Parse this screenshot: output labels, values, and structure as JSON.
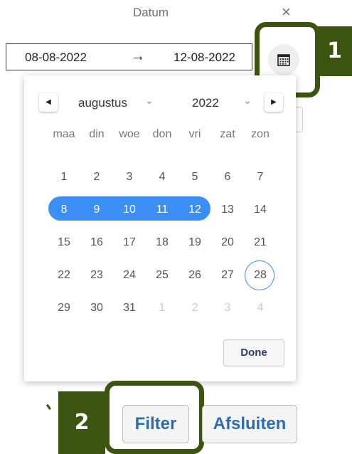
{
  "dialog": {
    "title": "Datum",
    "close_glyph": "×"
  },
  "date_range": {
    "start": "08-08-2022",
    "arrow": "→",
    "end": "12-08-2022"
  },
  "calendar_button": {
    "icon": "calendar-icon"
  },
  "callouts": {
    "one": "1",
    "two": "2"
  },
  "picker": {
    "prev_glyph": "◀",
    "next_glyph": "▶",
    "month": "augustus",
    "year": "2022",
    "chevron": "⌄",
    "weekdays": [
      "maa",
      "din",
      "woe",
      "don",
      "vri",
      "zat",
      "zon"
    ],
    "weeks": [
      [
        "1",
        "2",
        "3",
        "4",
        "5",
        "6",
        "7"
      ],
      [
        "8",
        "9",
        "10",
        "11",
        "12",
        "13",
        "14"
      ],
      [
        "15",
        "16",
        "17",
        "18",
        "19",
        "20",
        "21"
      ],
      [
        "22",
        "23",
        "24",
        "25",
        "26",
        "27",
        "28"
      ],
      [
        "29",
        "30",
        "31",
        "1",
        "2",
        "3",
        "4"
      ]
    ],
    "selected_range": [
      "8",
      "9",
      "10",
      "11",
      "12"
    ],
    "today": "28",
    "done_label": "Done"
  },
  "footer": {
    "filter_label": "Filter",
    "close_label": "Afsluiten"
  },
  "colors": {
    "accent": "#3a8ef6",
    "callout": "#3b5410",
    "button_text": "#2d6cae"
  }
}
